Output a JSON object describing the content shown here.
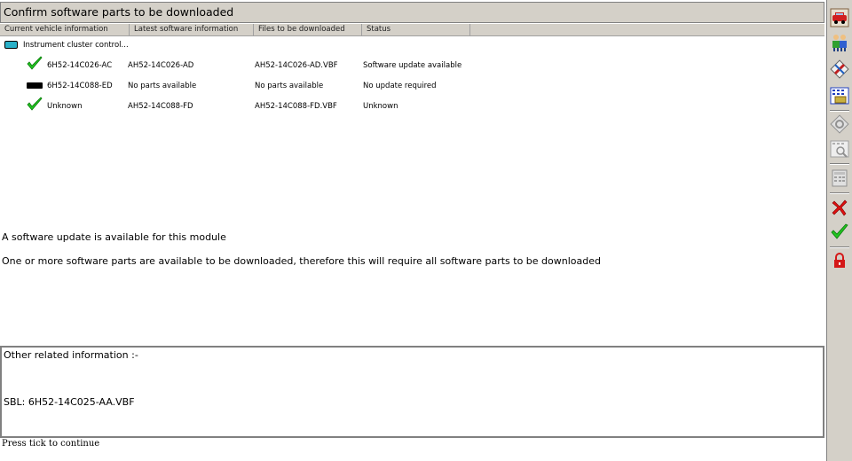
{
  "window": {
    "title": "Confirm software parts to be downloaded"
  },
  "columns": [
    "Current vehicle information",
    "Latest software information",
    "Files to be downloaded",
    "Status"
  ],
  "tree": {
    "root_label": "Instrument cluster control...",
    "rows": [
      {
        "icon": "check-icon",
        "current": "6H52-14C026-AC",
        "latest": "AH52-14C026-AD",
        "files": "AH52-14C026-AD.VBF",
        "status": "Software update available"
      },
      {
        "icon": "module-block-icon",
        "current": "6H52-14C088-ED",
        "latest": "No parts available",
        "files": "No parts available",
        "status": "No update required"
      },
      {
        "icon": "check-icon",
        "current": "Unknown",
        "latest": "AH52-14C088-FD",
        "files": "AH52-14C088-FD.VBF",
        "status": "Unknown"
      }
    ]
  },
  "messages": {
    "line1": "A software update is available for this module",
    "line2": "One or more software parts are available to be downloaded, therefore this will require all software parts to be downloaded"
  },
  "other_info": {
    "title": "Other related information :-",
    "sbl": "SBL: 6H52-14C025-AA.VBF"
  },
  "status_bar": {
    "text": "Press tick to continue"
  },
  "toolbar_icons": [
    "vehicle-icon",
    "people-icon",
    "tools-icon",
    "data-grid-icon",
    "gear-disabled-icon",
    "search-grid-disabled-icon",
    "calculator-disabled-icon",
    "cancel-icon",
    "confirm-tick-icon",
    "lock-icon"
  ],
  "colors": {
    "tick_green": "#22c422",
    "cancel_red": "#e01010",
    "lock_red": "#d41818",
    "ecu_cyan": "#2ab0c8",
    "panel_gray": "#d4d0c8"
  }
}
